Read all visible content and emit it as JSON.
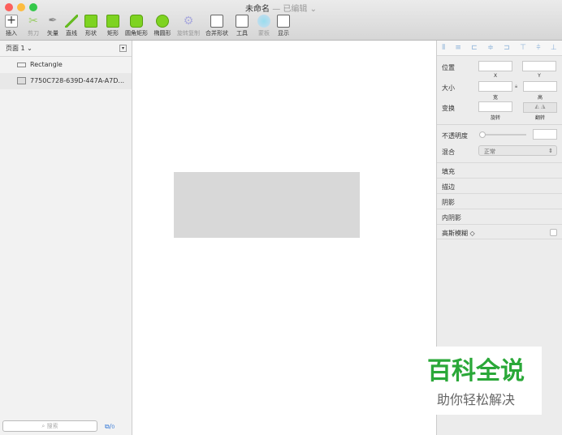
{
  "window": {
    "title": "未命名",
    "status": "— 已编辑 ⌄"
  },
  "toolbar": [
    {
      "label": "插入",
      "icon": "plus-icon"
    },
    {
      "label": "剪刀",
      "icon": "scissors-icon"
    },
    {
      "label": "矢量",
      "icon": "pen-icon"
    },
    {
      "label": "直线",
      "icon": "line-icon"
    },
    {
      "label": "形状",
      "icon": "shapes-icon"
    },
    {
      "label": "矩形",
      "icon": "rectangle-icon"
    },
    {
      "label": "圆角矩形",
      "icon": "rounded-rect-icon"
    },
    {
      "label": "椭圆形",
      "icon": "oval-icon"
    },
    {
      "label": "旋转复制",
      "icon": "rotate-copy-icon"
    },
    {
      "label": "合并形状",
      "icon": "combine-icon"
    },
    {
      "label": "工具",
      "icon": "tools-icon"
    },
    {
      "label": "蒙板",
      "icon": "mask-icon"
    },
    {
      "label": "显示",
      "icon": "view-icon"
    }
  ],
  "left": {
    "page": "页面 1 ⌄",
    "layers": [
      "Rectangle",
      "7750C728-639D-447A-A7D..."
    ],
    "search_placeholder": "搜索",
    "count": "0"
  },
  "inspector": {
    "position": "位置",
    "x": "X",
    "y": "Y",
    "size": "大小",
    "w": "宽",
    "h": "高",
    "transform": "变换",
    "rotate": "旋转",
    "flip": "翻转",
    "opacity": "不透明度",
    "blend": "混合",
    "blend_value": "正常",
    "sections": [
      "填充",
      "描边",
      "阴影",
      "内阴影"
    ],
    "blur": "高斯模糊 ◇"
  },
  "watermark": {
    "title": "百科全说",
    "subtitle": "助你轻松解决"
  }
}
